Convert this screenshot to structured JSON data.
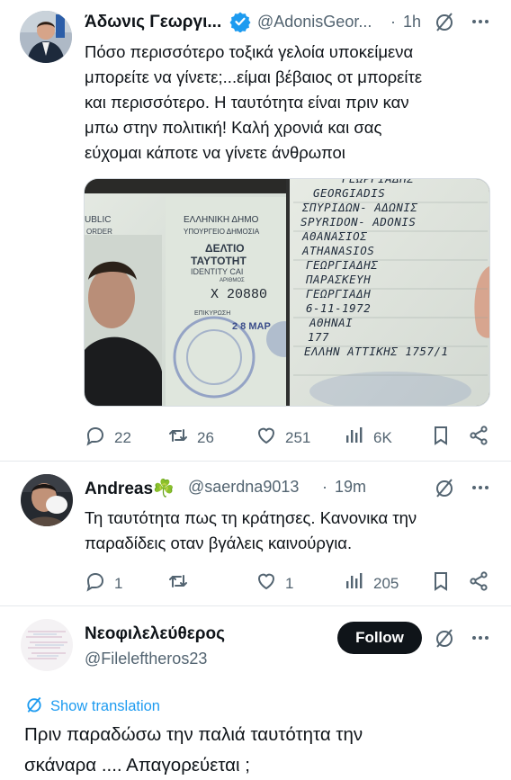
{
  "tweet1": {
    "author_name": "Άδωνις Γεωργι...",
    "handle": "@AdonisGeor...",
    "separator": "·",
    "time": "1h",
    "text_lines": [
      "Πόσο περισσότερο τοξικά γελοία υποκείμενα",
      "μπορείτε να γίνετε;...είμαι βέβαιος οτ μπορείτε",
      "και περισσότερο. Η ταυτότητα είναι πριν καν",
      "μπω στην πολιτική! Καλή χρονιά και σας",
      "εύχομαι κάποτε να γίνετε άνθρωποι"
    ],
    "media": {
      "left_text": {
        "republic": "UBLIC",
        "order": "ORDER",
        "hellenic": "ΕΛΛΗΝΙΚΗ ΔΗΜΟ",
        "ministry": "ΥΠΟΥΡΓΕΙΟ ΔΗΜΟΣΙΑ",
        "deltio": "ΔΕΛΤΙΟ",
        "tautotitas": "ΤΑΥΤΟΤΗΤ",
        "identity": "IDENTITY CAI",
        "arithmos": "ΑΡΙΘΜΟΣ",
        "number": "Χ 20880",
        "ekdosis": "ΕΠΙΚΥΡΩΣΗ",
        "stamp_date": "2 8 ΜΑΡ"
      },
      "right_text": {
        "line0": "ΓΕΩΡΓΙΑΔΗΣ",
        "line1": "GEORGIADIS",
        "line2": "ΣΠΥΡΙΔΩΝ- ΑΔΩΝΙΣ",
        "line3": "SPYRIDON- ADONIS",
        "line4": "ΑΘΑΝΑΣΙΟΣ",
        "line5": "ATHANASIOS",
        "line6": "ΓΕΩΡΓΙΑΔΗΣ",
        "line7": "ΠΑΡΑΣΚΕΥΗ",
        "line8": "ΓΕΩΡΓΙΑΔΗ",
        "line9": "6-11-1972",
        "line10": "ΑΘΗΝΑΙ",
        "line11": "177",
        "line12": "ΕΛΛΗΝ ΑΤΤΙΚΗΣ 1757/1"
      }
    },
    "actions": {
      "replies": "22",
      "retweets": "26",
      "likes": "251",
      "views": "6K"
    }
  },
  "tweet2": {
    "author_name": "Andreas☘️",
    "handle": "@saerdna9013",
    "separator": "·",
    "time": "19m",
    "text_lines": [
      "Τη ταυτότητα πως τη κράτησες. Κανονικα την",
      "παραδίδεις οταν βγάλεις καινούργια."
    ],
    "actions": {
      "replies": "1",
      "retweets": "",
      "likes": "1",
      "views": "205"
    }
  },
  "tweet3": {
    "author_name": "Νεοφιλελεύθερος",
    "handle": "@Fileleftheros23",
    "follow_label": "Follow",
    "show_translation": "Show translation",
    "text_lines": [
      "Πριν παραδώσω την παλιά ταυτότητα την",
      "σκάναρα .... Απαγορεύεται ;"
    ]
  },
  "colors": {
    "accent": "#1d9bf0",
    "text": "#0f1419",
    "muted": "#536471",
    "verified": "#1d9bf0",
    "follow_bg": "#0f1419"
  },
  "icons": [
    "grok-icon",
    "more-icon",
    "reply-icon",
    "retweet-icon",
    "like-icon",
    "views-icon",
    "bookmark-icon",
    "share-icon",
    "verified-icon",
    "translate-icon"
  ]
}
